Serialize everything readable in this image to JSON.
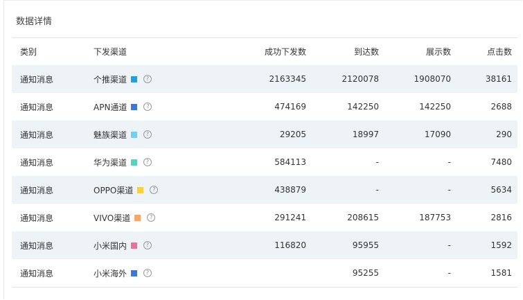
{
  "panel": {
    "title": "数据详情"
  },
  "table": {
    "headers": {
      "type": "类别",
      "channel": "下发渠道",
      "success": "成功下发数",
      "arrive": "到达数",
      "show": "展示数",
      "click": "点击数"
    },
    "rows": [
      {
        "type": "通知消息",
        "channel": "个推渠道",
        "color": "#1fa0e0",
        "success": "2163345",
        "arrive": "2120078",
        "show": "1908070",
        "click": "38161"
      },
      {
        "type": "通知消息",
        "channel": "APN通道",
        "color": "#3b78d8",
        "success": "474169",
        "arrive": "142250",
        "show": "142250",
        "click": "2688"
      },
      {
        "type": "通知消息",
        "channel": "魅族渠道",
        "color": "#6fd0f4",
        "success": "29205",
        "arrive": "18997",
        "show": "17090",
        "click": "290"
      },
      {
        "type": "通知消息",
        "channel": "华为渠道",
        "color": "#55d2c2",
        "success": "584113",
        "arrive": "-",
        "show": "-",
        "click": "7480"
      },
      {
        "type": "通知消息",
        "channel": "OPPO渠道",
        "color": "#f6d046",
        "success": "438879",
        "arrive": "-",
        "show": "-",
        "click": "5634"
      },
      {
        "type": "通知消息",
        "channel": "VIVO渠道",
        "color": "#f5a66a",
        "success": "291241",
        "arrive": "208615",
        "show": "187753",
        "click": "2816"
      },
      {
        "type": "通知消息",
        "channel": "小米国内",
        "color": "#e8739a",
        "success": "116820",
        "arrive": "95955",
        "show": "-",
        "click": "1592"
      },
      {
        "type": "通知消息",
        "channel": "小米海外",
        "color": "#3b78d8",
        "success": "",
        "arrive": "95255",
        "show": "-",
        "click": "1581"
      }
    ],
    "help_icon": "question-circle-icon",
    "help_glyph": "?"
  }
}
